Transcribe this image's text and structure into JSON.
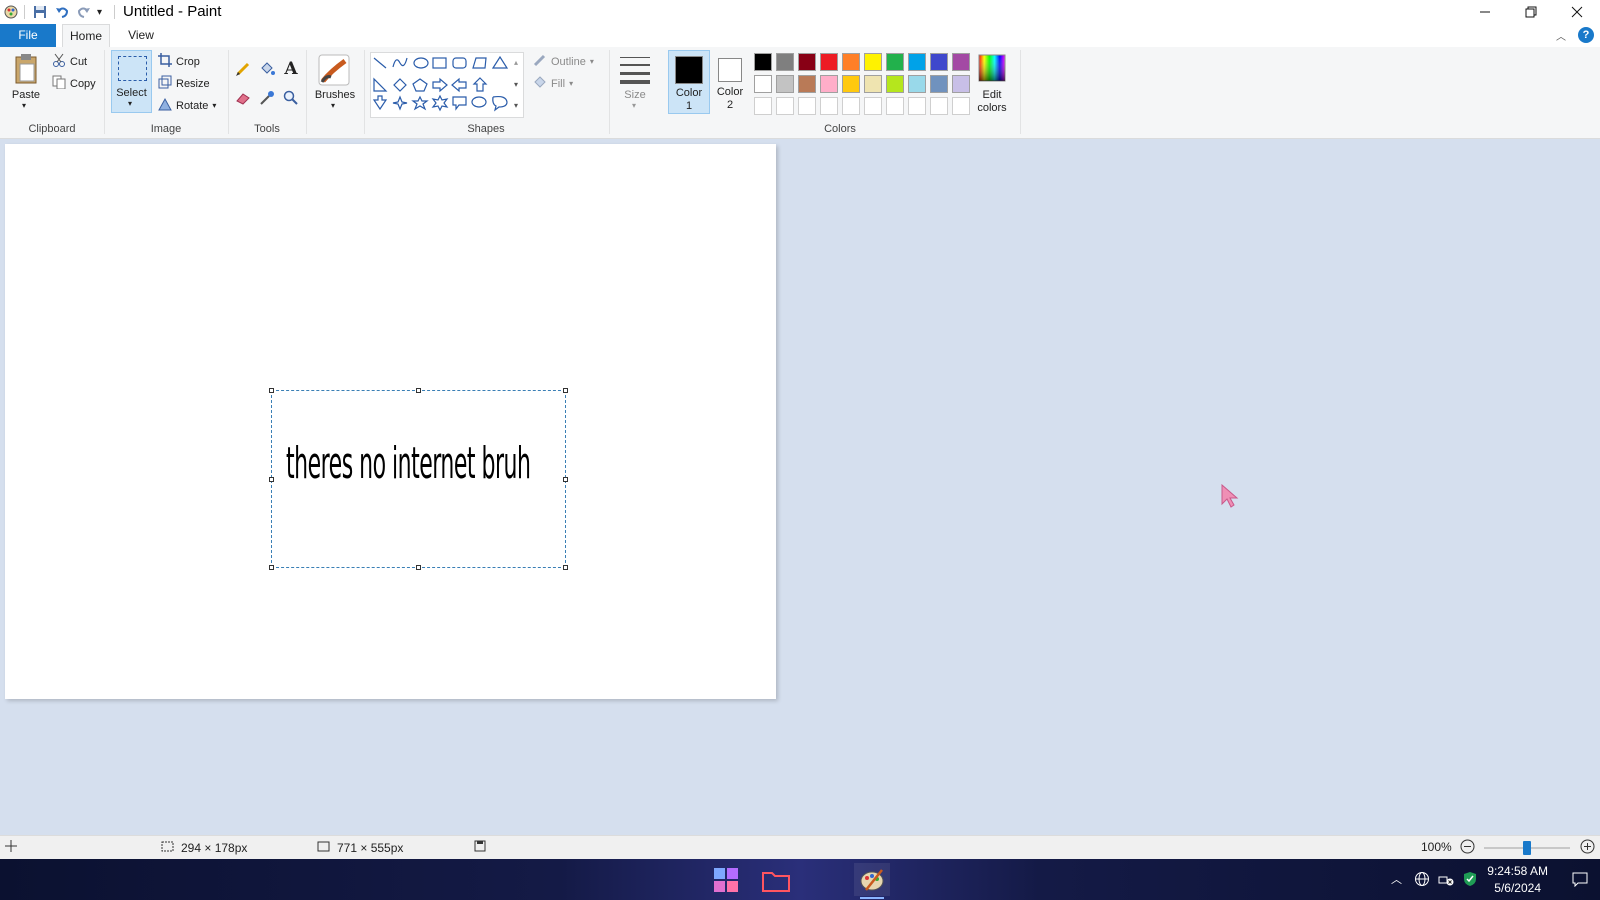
{
  "window": {
    "title": "Untitled - Paint",
    "minimize_icon": "minimize-icon",
    "maximize_icon": "restore-icon",
    "close_icon": "close-icon"
  },
  "tabs": [
    {
      "label": "File"
    },
    {
      "label": "Home"
    },
    {
      "label": "View"
    }
  ],
  "ribbon": {
    "clipboard": {
      "paste": "Paste",
      "cut": "Cut",
      "copy": "Copy",
      "group": "Clipboard"
    },
    "image": {
      "select": "Select",
      "crop": "Crop",
      "resize": "Resize",
      "rotate": "Rotate",
      "group": "Image"
    },
    "tools": {
      "group": "Tools"
    },
    "brushes": {
      "label": "Brushes"
    },
    "shapes": {
      "outline": "Outline",
      "fill": "Fill",
      "group": "Shapes"
    },
    "size": {
      "label": "Size"
    },
    "colors": {
      "color1_label": "Color",
      "color1_num": "1",
      "color2_label": "Color",
      "color2_num": "2",
      "edit_label": "Edit",
      "edit_label2": "colors",
      "group": "Colors",
      "color1": "#000000",
      "color2": "#ffffff",
      "palette_row1": [
        "#000000",
        "#7f7f7f",
        "#880015",
        "#ed1c24",
        "#ff7f27",
        "#fff200",
        "#22b14c",
        "#00a2e8",
        "#3f48cc",
        "#a349a4"
      ],
      "palette_row2": [
        "#ffffff",
        "#c3c3c3",
        "#b97a57",
        "#ffaec9",
        "#ffc90e",
        "#efe4b0",
        "#b5e61d",
        "#99d9ea",
        "#7092be",
        "#c8bfe7"
      ]
    }
  },
  "canvas": {
    "text": "theres no internet bruh"
  },
  "status": {
    "selection_size": "294 × 178px",
    "canvas_size": "771 × 555px",
    "zoom": "100%",
    "zoom_fraction": 0.5
  },
  "taskbar": {
    "time": "9:24:58 AM",
    "date": "5/6/2024"
  }
}
